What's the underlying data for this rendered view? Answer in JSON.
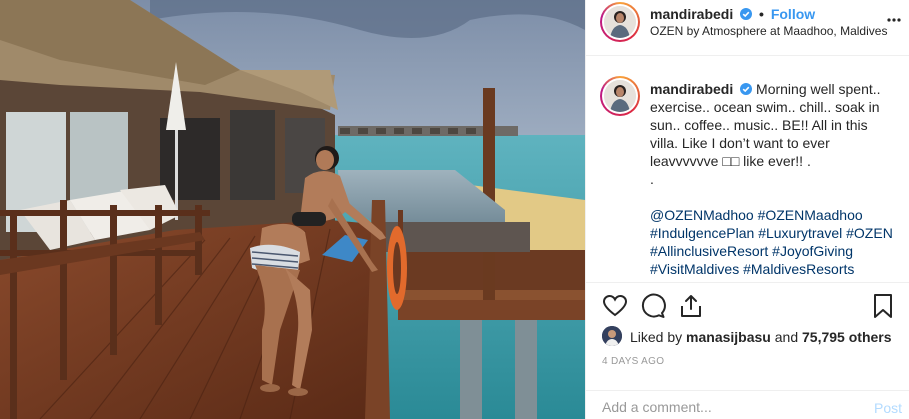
{
  "post": {
    "username": "mandirabedi",
    "follow_label": "Follow",
    "location": "OZEN by Atmosphere at Maadhoo, Maldives",
    "more_label": "...",
    "caption": {
      "username": "mandirabedi",
      "lines": [
        "Morning well spent..",
        "exercise.. ocean swim.. chill.. soak in",
        "sun.. coffee.. music.. BE!! All in this",
        "villa. Like I don’t want to ever",
        "leavvvvvve □□ like ever!! .",
        "."
      ],
      "hashtag_lines": [
        "@OZENMadhoo #OZENMaadhoo",
        "#IndulgencePlan #Luxurytravel #OZEN",
        "#AllinclusiveResort #JoyofGiving",
        "#VisitMaldives #MaldivesResorts"
      ]
    },
    "likes": {
      "prefix": "Liked by ",
      "user": "manasijbasu",
      "middle": " and ",
      "count": "75,795 others"
    },
    "timestamp": "4 DAYS AGO",
    "comment": {
      "placeholder": "Add a comment...",
      "post_label": "Post"
    }
  },
  "icons": {
    "verified": "verified-badge-icon",
    "like": "heart-icon",
    "comment": "comment-bubble-icon",
    "share": "share-icon",
    "save": "bookmark-icon",
    "more": "more-options-icon"
  },
  "colors": {
    "link_blue": "#3897f0",
    "hashtag": "#003569",
    "muted": "#999999",
    "post_disabled": "#b3dbff"
  }
}
